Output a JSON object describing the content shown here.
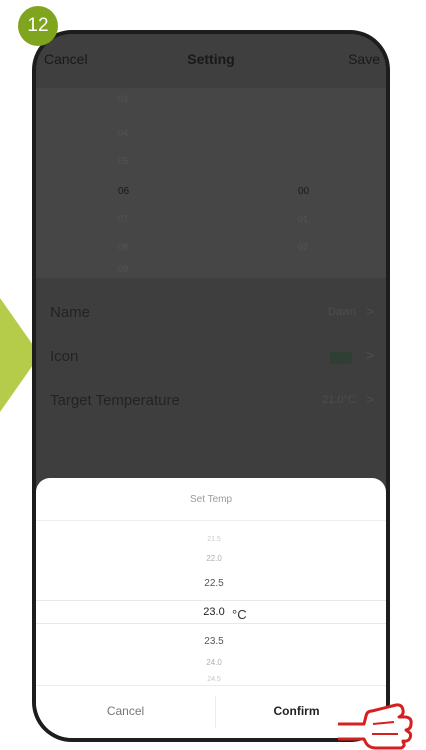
{
  "step_badge": "12",
  "header": {
    "cancel": "Cancel",
    "title": "Setting",
    "save": "Save"
  },
  "time_picker": {
    "hours": [
      "03",
      "04",
      "05",
      "06",
      "07",
      "08",
      "09"
    ],
    "minutes": [
      "",
      "",
      "",
      "00",
      "01",
      "02",
      ""
    ],
    "selected_hour": "06",
    "selected_minute": "00"
  },
  "settings": {
    "name_label": "Name",
    "name_value": "Dawn",
    "icon_label": "Icon",
    "target_label": "Target Temperature",
    "target_value": "21.0°C"
  },
  "temp_sheet": {
    "title": "Set Temp",
    "options": [
      "21.5",
      "22.0",
      "22.5",
      "23.0",
      "23.5",
      "24.0",
      "24.5"
    ],
    "selected": "23.0",
    "unit": "°C",
    "cancel": "Cancel",
    "confirm": "Confirm"
  },
  "colors": {
    "accent": "#7fa51f",
    "arrow": "#b5cc4a",
    "overlay": "#3e3e3e"
  }
}
